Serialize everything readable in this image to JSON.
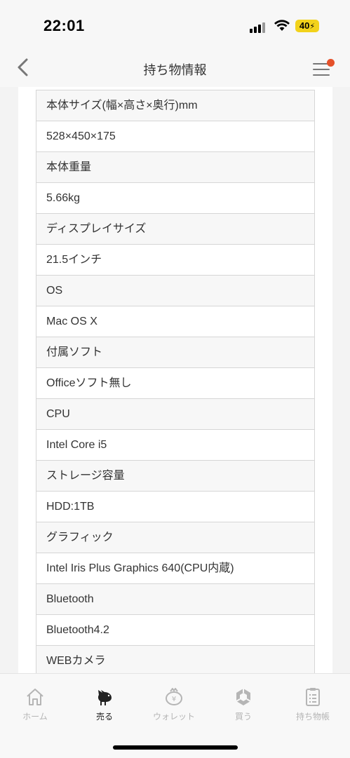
{
  "status_bar": {
    "time": "22:01",
    "battery": "40"
  },
  "header": {
    "title": "持ち物情報",
    "back_icon": "chevron-left-icon",
    "menu_icon": "hamburger-menu-icon",
    "notification_color": "#e5512a"
  },
  "specs": [
    {
      "kind": "label",
      "text": "本体サイズ(幅×高さ×奥行)mm"
    },
    {
      "kind": "value",
      "text": "528×450×175"
    },
    {
      "kind": "label",
      "text": "本体重量"
    },
    {
      "kind": "value",
      "text": "5.66kg"
    },
    {
      "kind": "label",
      "text": "ディスプレイサイズ"
    },
    {
      "kind": "value",
      "text": "21.5インチ"
    },
    {
      "kind": "label",
      "text": "OS"
    },
    {
      "kind": "value",
      "text": "Mac OS X"
    },
    {
      "kind": "label",
      "text": "付属ソフト"
    },
    {
      "kind": "value",
      "text": "Officeソフト無し"
    },
    {
      "kind": "label",
      "text": "CPU"
    },
    {
      "kind": "value",
      "text": "Intel Core i5"
    },
    {
      "kind": "label",
      "text": "ストレージ容量"
    },
    {
      "kind": "value",
      "text": "HDD:1TB"
    },
    {
      "kind": "label",
      "text": "グラフィック"
    },
    {
      "kind": "value",
      "text": "Intel Iris Plus Graphics 640(CPU内蔵)"
    },
    {
      "kind": "label",
      "text": "Bluetooth"
    },
    {
      "kind": "value",
      "text": "Bluetooth4.2"
    },
    {
      "kind": "label",
      "text": "WEBカメラ"
    }
  ],
  "tabs": [
    {
      "label": "ホーム",
      "icon": "home-icon",
      "active": false
    },
    {
      "label": "売る",
      "icon": "bird-icon",
      "active": true
    },
    {
      "label": "ウォレット",
      "icon": "wallet-icon",
      "active": false
    },
    {
      "label": "買う",
      "icon": "shop-icon",
      "active": false
    },
    {
      "label": "持ち物帳",
      "icon": "list-icon",
      "active": false
    }
  ]
}
